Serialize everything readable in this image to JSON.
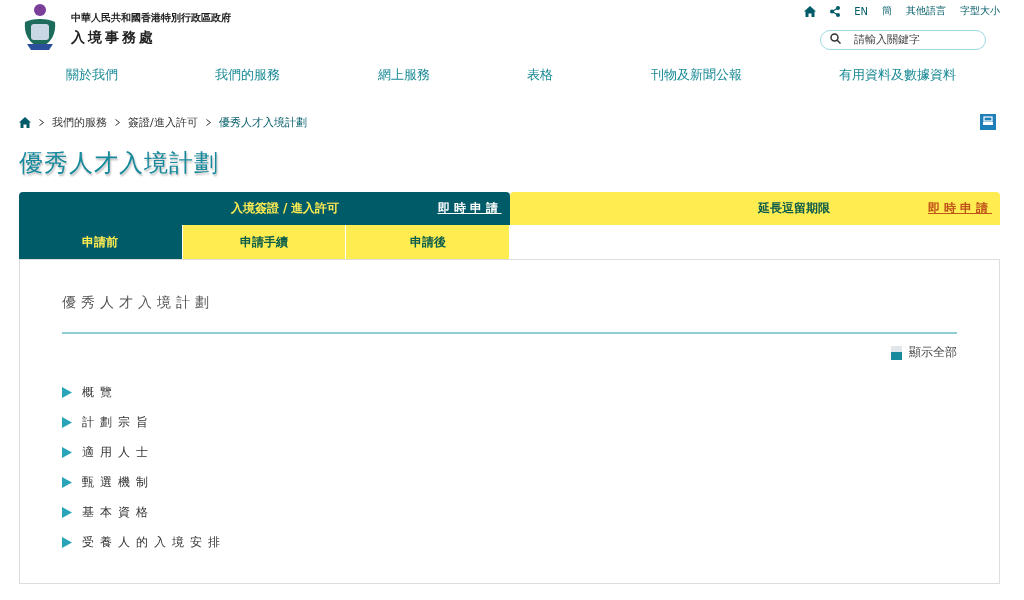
{
  "header": {
    "government": "中華人民共和國香港特別行政區政府",
    "department": "入境事務處",
    "utility_links": [
      "EN",
      "簡",
      "其他語言",
      "字型大小"
    ],
    "search": {
      "placeholder": "請輸入關鍵字"
    }
  },
  "nav": [
    "關於我們",
    "我們的服務",
    "網上服務",
    "表格",
    "刊物及新聞公報",
    "有用資料及數據資料"
  ],
  "breadcrumb": [
    "我們的服務",
    "簽證/進入許可",
    "優秀人才入境計劃"
  ],
  "page_title": "優秀人才入境計劃",
  "tabs": [
    {
      "label": "入境簽證 / 進入許可",
      "link": "即時申請",
      "selected": true
    },
    {
      "label": "延長逗留期限",
      "link": "即時申請",
      "selected": false
    }
  ],
  "subtabs": [
    {
      "label": "申請前",
      "selected": true
    },
    {
      "label": "申請手續",
      "selected": false
    },
    {
      "label": "申請後",
      "selected": false
    }
  ],
  "content": {
    "heading": "優秀人才入境計劃",
    "show_all": "顯示全部",
    "sections": [
      {
        "label": "概覽",
        "expanded": false
      },
      {
        "label": "計劃宗旨",
        "expanded": false
      },
      {
        "label": "適用人士",
        "expanded": false
      },
      {
        "label": "甄選機制",
        "expanded": false
      },
      {
        "label": "基本資格",
        "expanded": false
      },
      {
        "label": "受養人的入境安排",
        "expanded": false
      }
    ]
  }
}
